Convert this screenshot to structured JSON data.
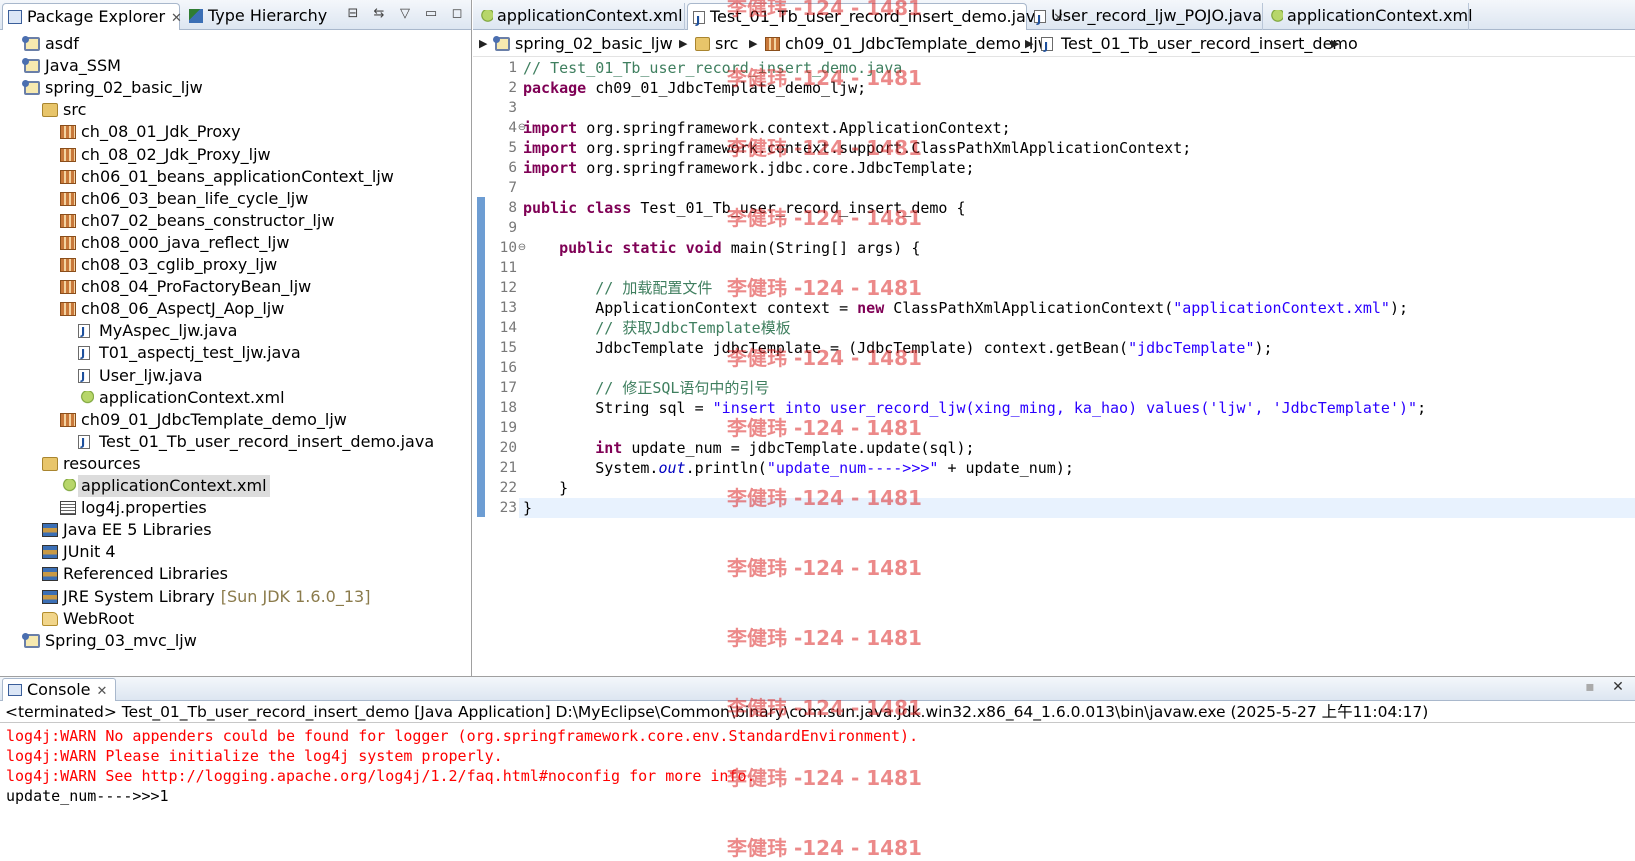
{
  "explorer": {
    "tabs": [
      {
        "label": "Package Explorer",
        "active": true,
        "closable": true
      },
      {
        "label": "Type Hierarchy",
        "active": false,
        "closable": false
      }
    ],
    "tree": [
      {
        "label": "asdf",
        "icon": "project-icon",
        "level": 0
      },
      {
        "label": "Java_SSM",
        "icon": "project-icon",
        "level": 0
      },
      {
        "label": "spring_02_basic_ljw",
        "icon": "project-icon",
        "level": 0
      },
      {
        "label": "src",
        "icon": "source-folder-icon",
        "level": 1
      },
      {
        "label": "ch_08_01_Jdk_Proxy",
        "icon": "package-icon",
        "level": 2
      },
      {
        "label": "ch_08_02_Jdk_Proxy_ljw",
        "icon": "package-icon",
        "level": 2
      },
      {
        "label": "ch06_01_beans_applicationContext_ljw",
        "icon": "package-icon",
        "level": 2
      },
      {
        "label": "ch06_03_bean_life_cycle_ljw",
        "icon": "package-icon",
        "level": 2
      },
      {
        "label": "ch07_02_beans_constructor_ljw",
        "icon": "package-icon",
        "level": 2
      },
      {
        "label": "ch08_000_java_reflect_ljw",
        "icon": "package-icon",
        "level": 2
      },
      {
        "label": "ch08_03_cglib_proxy_ljw",
        "icon": "package-icon",
        "level": 2
      },
      {
        "label": "ch08_04_ProFactoryBean_ljw",
        "icon": "package-icon",
        "level": 2
      },
      {
        "label": "ch08_06_AspectJ_Aop_ljw",
        "icon": "package-icon",
        "level": 2
      },
      {
        "label": "MyAspec_ljw.java",
        "icon": "java-file-icon",
        "level": 3
      },
      {
        "label": "T01_aspectj_test_ljw.java",
        "icon": "java-file-icon",
        "level": 3
      },
      {
        "label": "User_ljw.java",
        "icon": "java-file-icon",
        "level": 3
      },
      {
        "label": "applicationContext.xml",
        "icon": "xml-file-icon",
        "level": 3
      },
      {
        "label": "ch09_01_JdbcTemplate_demo_ljw",
        "icon": "package-icon",
        "level": 2
      },
      {
        "label": "Test_01_Tb_user_record_insert_demo.java",
        "icon": "java-file-icon",
        "level": 3
      },
      {
        "label": "resources",
        "icon": "source-folder-icon",
        "level": 1
      },
      {
        "label": "applicationContext.xml",
        "icon": "xml-file-icon",
        "level": 2,
        "selected": true
      },
      {
        "label": "log4j.properties",
        "icon": "properties-file-icon",
        "level": 2
      },
      {
        "label": "Java EE 5 Libraries",
        "icon": "library-icon",
        "level": 1
      },
      {
        "label": "JUnit 4",
        "icon": "library-icon",
        "level": 1
      },
      {
        "label": "Referenced Libraries",
        "icon": "library-icon",
        "level": 1
      },
      {
        "label": "JRE System Library",
        "icon": "library-icon",
        "level": 1,
        "extra": "[Sun JDK 1.6.0_13]"
      },
      {
        "label": "WebRoot",
        "icon": "folder-icon",
        "level": 1
      },
      {
        "label": "Spring_03_mvc_ljw",
        "icon": "project-icon",
        "level": 0
      }
    ]
  },
  "editor": {
    "tabs": [
      {
        "label": "applicationContext.xml",
        "icon": "xml-file-icon",
        "active": false
      },
      {
        "label": "Test_01_Tb_user_record_insert_demo.java",
        "icon": "java-file-icon",
        "active": true
      },
      {
        "label": "User_record_ljw_POJO.java",
        "icon": "java-file-icon",
        "active": false
      },
      {
        "label": "applicationContext.xml",
        "icon": "xml-file-icon",
        "active": false
      }
    ],
    "breadcrumb": [
      {
        "label": "spring_02_basic_ljw",
        "icon": "project-icon"
      },
      {
        "label": "src",
        "icon": "source-folder-icon"
      },
      {
        "label": "ch09_01_JdbcTemplate_demo_ljw",
        "icon": "package-icon"
      },
      {
        "label": "Test_01_Tb_user_record_insert_demo",
        "icon": "class-icon"
      }
    ],
    "current_line": 23,
    "fold_lines": [
      4,
      10
    ],
    "lines": [
      [
        [
          "cm",
          "// Test_01_Tb_user_record_insert_demo.java"
        ]
      ],
      [
        [
          "kw",
          "package"
        ],
        [
          "",
          " ch09_01_JdbcTemplate_demo_ljw;"
        ]
      ],
      [],
      [
        [
          "kw",
          "import"
        ],
        [
          "",
          " org.springframework.context.ApplicationContext;"
        ]
      ],
      [
        [
          "kw",
          "import"
        ],
        [
          "",
          " org.springframework.context.support.ClassPathXmlApplicationContext;"
        ]
      ],
      [
        [
          "kw",
          "import"
        ],
        [
          "",
          " org.springframework.jdbc.core.JdbcTemplate;"
        ]
      ],
      [],
      [
        [
          "kw",
          "public"
        ],
        [
          "",
          " "
        ],
        [
          "kw",
          "class"
        ],
        [
          "",
          " Test_01_Tb_user_record_insert_demo {"
        ]
      ],
      [],
      [
        [
          "",
          "    "
        ],
        [
          "kw",
          "public"
        ],
        [
          "",
          " "
        ],
        [
          "kw",
          "static"
        ],
        [
          "",
          " "
        ],
        [
          "kw",
          "void"
        ],
        [
          "",
          " main(String[] args) {"
        ]
      ],
      [],
      [
        [
          "",
          "        "
        ],
        [
          "cm",
          "// 加载配置文件"
        ]
      ],
      [
        [
          "",
          "        ApplicationContext context = "
        ],
        [
          "kw",
          "new"
        ],
        [
          "",
          " ClassPathXmlApplicationContext("
        ],
        [
          "st",
          "\"applicationContext.xml\""
        ],
        [
          "",
          ");"
        ]
      ],
      [
        [
          "",
          "        "
        ],
        [
          "cm",
          "// 获取JdbcTemplate模板"
        ]
      ],
      [
        [
          "",
          "        JdbcTemplate jdbcTemplate = (JdbcTemplate) context.getBean("
        ],
        [
          "st",
          "\"jdbcTemplate\""
        ],
        [
          "",
          ");"
        ]
      ],
      [],
      [
        [
          "",
          "        "
        ],
        [
          "cm",
          "// 修正SQL语句中的引号"
        ]
      ],
      [
        [
          "",
          "        String sql = "
        ],
        [
          "st",
          "\"insert into user_record_ljw(xing_ming, ka_hao) values('ljw', 'JdbcTemplate')\""
        ],
        [
          "",
          ";"
        ]
      ],
      [],
      [
        [
          "",
          "        "
        ],
        [
          "kw",
          "int"
        ],
        [
          "",
          " update_num = jdbcTemplate.update(sql);"
        ]
      ],
      [
        [
          "",
          "        System."
        ],
        [
          "it",
          "out"
        ],
        [
          "",
          ".println("
        ],
        [
          "st",
          "\"update_num---->>>\""
        ],
        [
          "",
          " + update_num);"
        ]
      ],
      [
        [
          "",
          "    }"
        ]
      ],
      [
        [
          "",
          "}"
        ]
      ]
    ]
  },
  "console": {
    "tab_label": "Console",
    "description": "<terminated> Test_01_Tb_user_record_insert_demo [Java Application] D:\\MyEclipse\\Common\\binary\\com.sun.java.jdk.win32.x86_64_1.6.0.013\\bin\\javaw.exe (2025-5-27 上午11:04:17)",
    "output": [
      {
        "type": "err",
        "text": "log4j:WARN No appenders could be found for logger (org.springframework.core.env.StandardEnvironment)."
      },
      {
        "type": "err",
        "text": "log4j:WARN Please initialize the log4j system properly."
      },
      {
        "type": "err",
        "text": "log4j:WARN See http://logging.apache.org/log4j/1.2/faq.html#noconfig for more info."
      },
      {
        "type": "out",
        "text": "update_num---->>>1"
      }
    ]
  },
  "watermark": {
    "text": "李健玮 -124 - 1481",
    "color": "#dc2828",
    "count": 13
  },
  "colors": {
    "keyword": "#7f0055",
    "comment": "#3f7f5f",
    "string": "#2a00ff",
    "field": "#0000c0",
    "error_output": "#ff0000",
    "current_line": "#e8f2fe",
    "change_bar": "#6d9dd3"
  }
}
